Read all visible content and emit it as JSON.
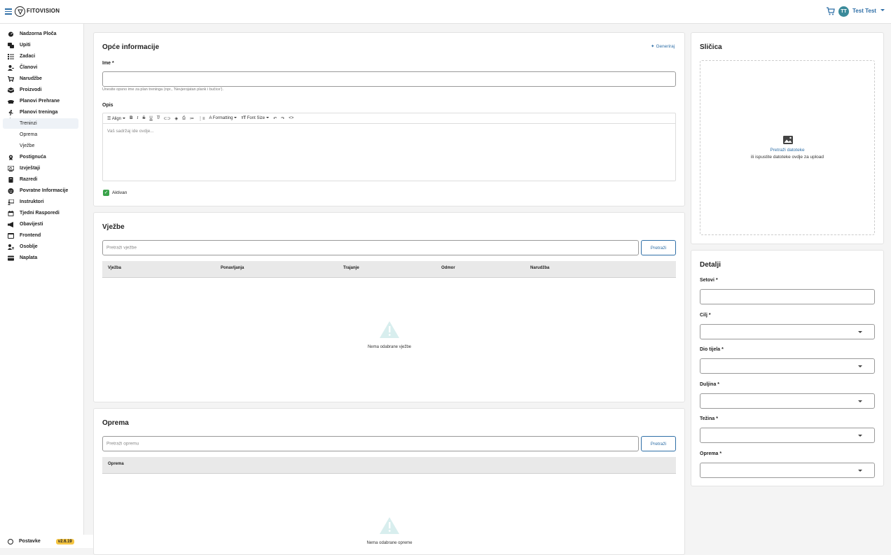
{
  "app": {
    "name": "FITOVISION"
  },
  "user": {
    "initials": "TT",
    "name": "Test Test"
  },
  "sidebar": {
    "items": [
      {
        "label": "Nadzorna Ploča",
        "icon": "dashboard-icon"
      },
      {
        "label": "Upiti",
        "icon": "chat-icon"
      },
      {
        "label": "Zadaci",
        "icon": "tasks-icon"
      },
      {
        "label": "Članovi",
        "icon": "members-icon"
      },
      {
        "label": "Narudžbe",
        "icon": "cart-icon"
      },
      {
        "label": "Proizvodi",
        "icon": "box-icon"
      },
      {
        "label": "Planovi Prehrane",
        "icon": "food-icon"
      },
      {
        "label": "Planovi treninga",
        "icon": "run-icon"
      },
      {
        "label": "Treninzi",
        "sub": true,
        "active": true
      },
      {
        "label": "Oprema",
        "sub": true
      },
      {
        "label": "Vježbe",
        "sub": true
      },
      {
        "label": "Postignuća",
        "icon": "award-icon"
      },
      {
        "label": "Izvještaji",
        "icon": "report-icon"
      },
      {
        "label": "Razredi",
        "icon": "class-icon"
      },
      {
        "label": "Povratne Informacije",
        "icon": "feedback-icon"
      },
      {
        "label": "Instruktori",
        "icon": "instructor-icon"
      },
      {
        "label": "Tjedni Rasporedi",
        "icon": "calendar-icon"
      },
      {
        "label": "Obavijesti",
        "icon": "megaphone-icon"
      },
      {
        "label": "Frontend",
        "icon": "frontend-icon"
      },
      {
        "label": "Osoblje",
        "icon": "staff-icon"
      },
      {
        "label": "Naplata",
        "icon": "billing-icon"
      }
    ],
    "settings_label": "Postavke",
    "version": "v2.6.19"
  },
  "general": {
    "title": "Opće informacije",
    "generate_label": "Generiraj",
    "name_label": "Ime *",
    "name_value": "",
    "name_hint": "Unesite opsno ime za plan treninga (npr., 'Nevjerojatan plank i bučice').",
    "desc_label": "Opis",
    "toolbar": {
      "align": "Align",
      "formatting": "Formatting",
      "font_size": "Font Size"
    },
    "editor_placeholder": "Vaš sadržaj ide ovdje...",
    "active_label": "Aktivan",
    "active": true
  },
  "exercises": {
    "title": "Vježbe",
    "search_placeholder": "Pretraži vježbe",
    "search_button": "Pretraži",
    "columns": [
      "Vježba",
      "Ponavljanja",
      "Trajanje",
      "Odmor",
      "Narudžba"
    ],
    "empty": "Nema odabrane vježbe"
  },
  "equipment": {
    "title": "Oprema",
    "search_placeholder": "Pretraži opremu",
    "search_button": "Pretraži",
    "columns": [
      "Oprema"
    ],
    "empty": "Nema odabrane opreme"
  },
  "thumbnail": {
    "title": "Sličica",
    "browse": "Pretraži datoteke",
    "drop": "ili ispustite datoteke ovdje za upload"
  },
  "details": {
    "title": "Detalji",
    "fields": [
      {
        "label": "Setovi *",
        "type": "text",
        "value": ""
      },
      {
        "label": "Cilj *",
        "type": "select",
        "value": ""
      },
      {
        "label": "Dio tijela *",
        "type": "select",
        "value": ""
      },
      {
        "label": "Duljina *",
        "type": "select",
        "value": ""
      },
      {
        "label": "Težina *",
        "type": "select",
        "value": ""
      },
      {
        "label": "Oprema *",
        "type": "select",
        "value": ""
      }
    ]
  },
  "colors": {
    "accent": "#2f6fa7",
    "success": "#3aa34a",
    "version_badge": "#f5c542"
  }
}
